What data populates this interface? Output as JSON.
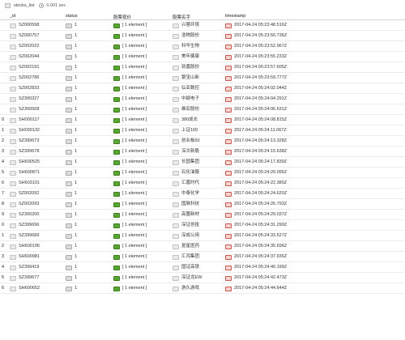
{
  "topbar": {
    "collection": "stocks_list",
    "elapsed": "0.001 sec"
  },
  "columns": [
    "_id",
    "status",
    "股票现价",
    "股票名字",
    "timestamp"
  ],
  "rows": [
    {
      "idx": "",
      "id": "SZ000598",
      "status": "1",
      "price": "[ 1 element ]",
      "name": "兴蓉环境",
      "ts": "2017-04-24 05:23:48.516Z"
    },
    {
      "idx": "",
      "id": "SZ000757",
      "status": "1",
      "price": "[ 1 element ]",
      "name": "浩物股份",
      "ts": "2017-04-24 05:23:50.736Z"
    },
    {
      "idx": "",
      "id": "SZ002022",
      "status": "1",
      "price": "[ 1 element ]",
      "name": "科华生物",
      "ts": "2017-04-24 05:23:52.967Z"
    },
    {
      "idx": "",
      "id": "SZ002044",
      "status": "1",
      "price": "[ 1 element ]",
      "name": "美年健康",
      "ts": "2017-04-24 05:23:55.233Z"
    },
    {
      "idx": "",
      "id": "SZ002191",
      "status": "1",
      "price": "[ 1 element ]",
      "name": "劲嘉股份",
      "ts": "2017-04-24 05:23:57.605Z"
    },
    {
      "idx": "",
      "id": "SZ002786",
      "status": "1",
      "price": "[ 1 element ]",
      "name": "银宝山新",
      "ts": "2017-04-24 05:23:59.777Z"
    },
    {
      "idx": "",
      "id": "SZ002833",
      "status": "1",
      "price": "[ 1 element ]",
      "name": "弘亚数控",
      "ts": "2017-04-24 05:24:02.044Z"
    },
    {
      "idx": "",
      "id": "SZ300327",
      "status": "1",
      "price": "[ 1 element ]",
      "name": "中颖电子",
      "ts": "2017-04-24 05:24:04.291Z"
    },
    {
      "idx": "",
      "id": "SZ300508",
      "status": "1",
      "price": "[ 1 element ]",
      "name": "维宏股份",
      "ts": "2017-04-24 05:24:06.631Z"
    },
    {
      "idx": "0",
      "id": "SH000117",
      "status": "1",
      "price": "[ 1 element ]",
      "name": "380成长",
      "ts": "2017-04-24 05:24:08.815Z"
    },
    {
      "idx": "1",
      "id": "SH000132",
      "status": "1",
      "price": "[ 1 element ]",
      "name": "上证100",
      "ts": "2017-04-24 05:24:11.067Z"
    },
    {
      "idx": "2",
      "id": "SZ399673",
      "status": "1",
      "price": "[ 1 element ]",
      "name": "创业板50",
      "ts": "2017-04-24 05:24:13.328Z"
    },
    {
      "idx": "3",
      "id": "SZ399678",
      "status": "1",
      "price": "[ 1 element ]",
      "name": "深次新股",
      "ts": "2017-04-24 05:24:15.638Z"
    },
    {
      "idx": "4",
      "id": "SH600525",
      "status": "1",
      "price": "[ 1 element ]",
      "name": "长园集团",
      "ts": "2017-04-24 05:24:17.839Z"
    },
    {
      "idx": "5",
      "id": "SH600871",
      "status": "1",
      "price": "[ 1 element ]",
      "name": "石化油服",
      "ts": "2017-04-24 05:24:20.095Z"
    },
    {
      "idx": "6",
      "id": "SH603101",
      "status": "1",
      "price": "[ 1 element ]",
      "name": "汇嘉时代",
      "ts": "2017-04-24 05:24:22.380Z"
    },
    {
      "idx": "7",
      "id": "SZ002092",
      "status": "1",
      "price": "[ 1 element ]",
      "name": "中泰化学",
      "ts": "2017-04-24 05:24:24.620Z"
    },
    {
      "idx": "8",
      "id": "SZ002093",
      "status": "1",
      "price": "[ 1 element ]",
      "name": "国脉科技",
      "ts": "2017-04-24 05:24:26.793Z"
    },
    {
      "idx": "9",
      "id": "SZ300200",
      "status": "1",
      "price": "[ 1 element ]",
      "name": "高盟新材",
      "ts": "2017-04-24 05:24:29.037Z"
    },
    {
      "idx": "0",
      "id": "SZ399696",
      "status": "1",
      "price": "[ 1 element ]",
      "name": "深证创投",
      "ts": "2017-04-24 05:24:31.290Z"
    },
    {
      "idx": "1",
      "id": "SZ399689",
      "status": "1",
      "price": "[ 1 element ]",
      "name": "深成公用",
      "ts": "2017-04-24 05:24:33.527Z"
    },
    {
      "idx": "2",
      "id": "SH600196",
      "status": "1",
      "price": "[ 1 element ]",
      "name": "复星医药",
      "ts": "2017-04-24 05:24:35.696Z"
    },
    {
      "idx": "3",
      "id": "SH600981",
      "status": "1",
      "price": "[ 1 element ]",
      "name": "汇鸿集团",
      "ts": "2017-04-24 05:24:37.936Z"
    },
    {
      "idx": "4",
      "id": "SZ399419",
      "status": "1",
      "price": "[ 1 element ]",
      "name": "国证高铁",
      "ts": "2017-04-24 05:24:40.199Z"
    },
    {
      "idx": "5",
      "id": "SZ399677",
      "status": "1",
      "price": "[ 1 element ]",
      "name": "深证龙EW",
      "ts": "2017-04-24 05:24:42.473Z"
    },
    {
      "idx": "6",
      "id": "SH600652",
      "status": "1",
      "price": "[ 1 element ]",
      "name": "游久游戏",
      "ts": "2017-04-24 05:24:44.644Z"
    }
  ]
}
